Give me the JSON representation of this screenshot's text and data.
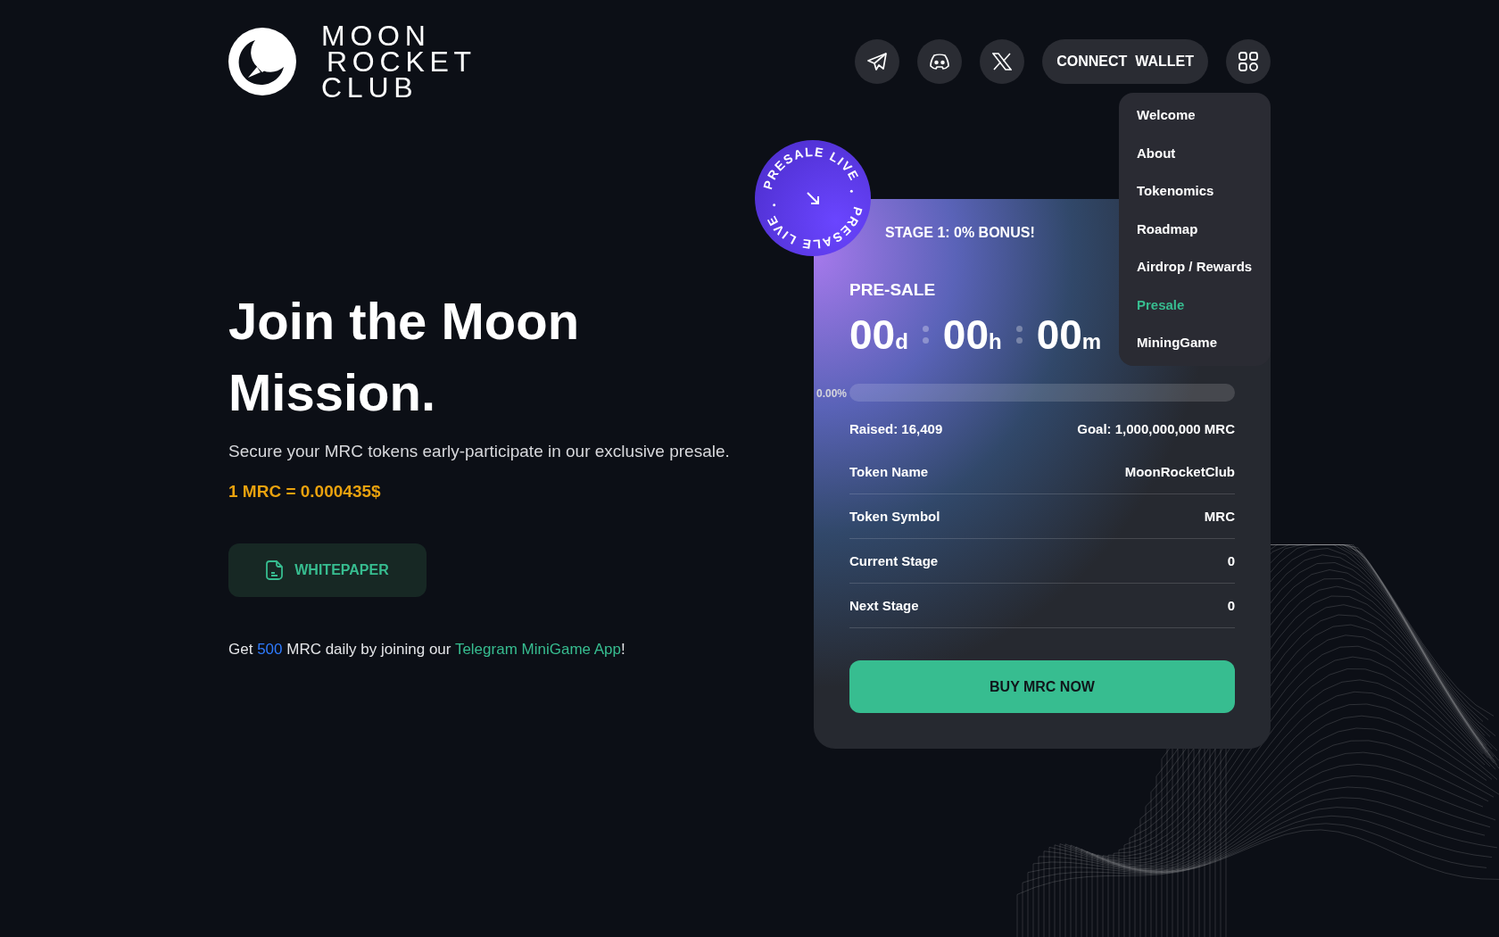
{
  "logo": {
    "lines": [
      "MOON",
      "ROCKET",
      "CLUB"
    ]
  },
  "header": {
    "social": [
      {
        "kind": "telegram"
      },
      {
        "kind": "discord"
      },
      {
        "kind": "x"
      }
    ],
    "connect_button": "CONNECT  WALLET"
  },
  "menu": {
    "expanded": true,
    "items": [
      {
        "label": "Welcome",
        "selected": false
      },
      {
        "label": "About",
        "selected": false
      },
      {
        "label": "Tokenomics",
        "selected": false
      },
      {
        "label": "Roadmap",
        "selected": false
      },
      {
        "label": "Airdrop / Rewards",
        "selected": false
      },
      {
        "label": "Presale",
        "selected": true
      },
      {
        "label": "MiningGame",
        "selected": false
      }
    ]
  },
  "hero": {
    "title": "Join the Moon Mission.",
    "subtitle": "Secure your MRC tokens early-participate in our exclusive presale.",
    "price": "1 MRC = 0.000435$",
    "whitepaper_button": "WHITEPAPER",
    "promo": [
      {
        "kind": "plain",
        "text": "Get "
      },
      {
        "kind": "highlight",
        "text": "500"
      },
      {
        "kind": "plain",
        "text": " MRC daily by joining our "
      },
      {
        "kind": "link",
        "text": "Telegram MiniGame App"
      },
      {
        "kind": "plain",
        "text": "!"
      }
    ]
  },
  "badge": {
    "texts": [
      "PRESALE LIVE",
      "PRESALE LIVE"
    ]
  },
  "card": {
    "stage": "STAGE 1: 0% BONUS!",
    "heading": "PRE-SALE",
    "countdown": [
      {
        "value": "00",
        "unit": "d"
      },
      {
        "value": "00",
        "unit": "h"
      },
      {
        "value": "00",
        "unit": "m"
      }
    ],
    "progress": {
      "label": "0.00%",
      "level": 0
    },
    "raised": "Raised: 16,409",
    "goal": "Goal: 1,000,000,000 MRC",
    "rows": [
      {
        "label": "Token Name",
        "value": "MoonRocketClub"
      },
      {
        "label": "Token Symbol",
        "value": "MRC"
      },
      {
        "label": "Current Stage",
        "value": "0"
      },
      {
        "label": "Next Stage",
        "value": "0"
      }
    ],
    "buy_button": "BUY MRC NOW"
  }
}
